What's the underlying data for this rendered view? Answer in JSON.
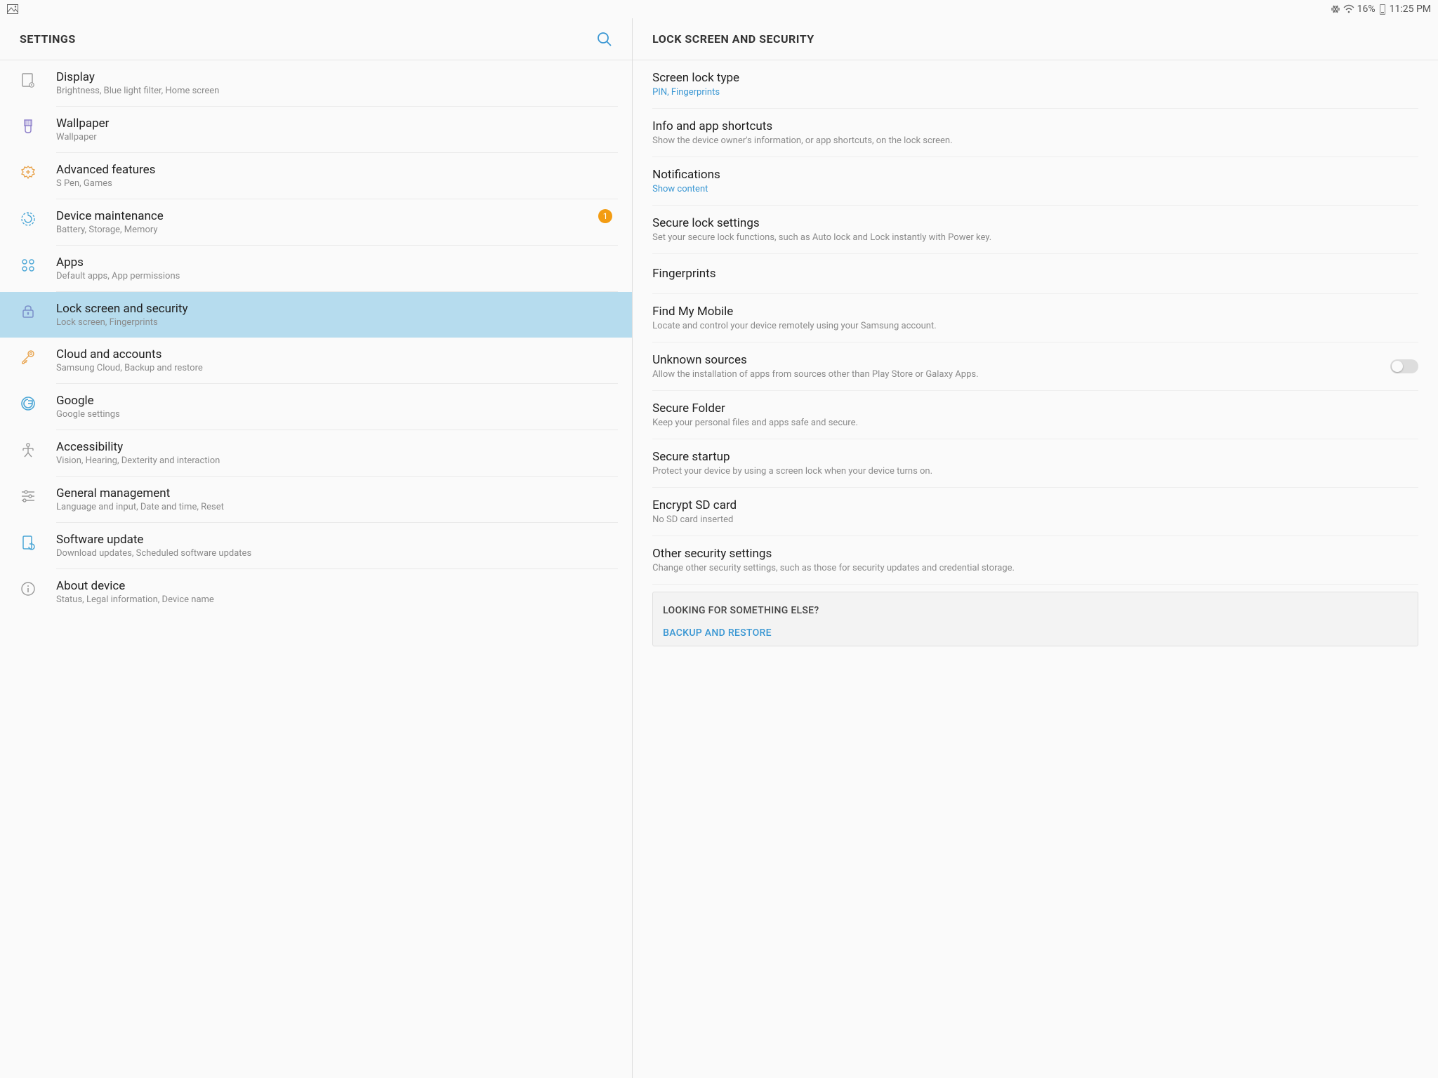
{
  "status": {
    "battery_pct": "16%",
    "time": "11:25 PM"
  },
  "left_header": "SETTINGS",
  "right_header": "LOCK SCREEN AND SECURITY",
  "sidebar": {
    "items": [
      {
        "title": "Display",
        "sub": "Brightness, Blue light filter, Home screen"
      },
      {
        "title": "Wallpaper",
        "sub": "Wallpaper"
      },
      {
        "title": "Advanced features",
        "sub": "S Pen, Games"
      },
      {
        "title": "Device maintenance",
        "sub": "Battery, Storage, Memory",
        "badge": "1"
      },
      {
        "title": "Apps",
        "sub": "Default apps, App permissions"
      },
      {
        "title": "Lock screen and security",
        "sub": "Lock screen, Fingerprints",
        "selected": true
      },
      {
        "title": "Cloud and accounts",
        "sub": "Samsung Cloud, Backup and restore"
      },
      {
        "title": "Google",
        "sub": "Google settings"
      },
      {
        "title": "Accessibility",
        "sub": "Vision, Hearing, Dexterity and interaction"
      },
      {
        "title": "General management",
        "sub": "Language and input, Date and time, Reset"
      },
      {
        "title": "Software update",
        "sub": "Download updates, Scheduled software updates"
      },
      {
        "title": "About device",
        "sub": "Status, Legal information, Device name"
      }
    ]
  },
  "details": {
    "items": [
      {
        "title": "Screen lock type",
        "sub": "PIN, Fingerprints",
        "link": true
      },
      {
        "title": "Info and app shortcuts",
        "sub": "Show the device owner's information, or app shortcuts, on the lock screen."
      },
      {
        "title": "Notifications",
        "sub": "Show content",
        "link": true
      },
      {
        "title": "Secure lock settings",
        "sub": "Set your secure lock functions, such as Auto lock and Lock instantly with Power key."
      }
    ],
    "fingerprints_header": "Fingerprints",
    "items2": [
      {
        "title": "Find My Mobile",
        "sub": "Locate and control your device remotely using your Samsung account."
      },
      {
        "title": "Unknown sources",
        "sub": "Allow the installation of apps from sources other than Play Store or Galaxy Apps.",
        "toggle": true
      },
      {
        "title": "Secure Folder",
        "sub": "Keep your personal files and apps safe and secure."
      },
      {
        "title": "Secure startup",
        "sub": "Protect your device by using a screen lock when your device turns on."
      },
      {
        "title": "Encrypt SD card",
        "sub": "No SD card inserted"
      },
      {
        "title": "Other security settings",
        "sub": "Change other security settings, such as those for security updates and credential storage."
      }
    ]
  },
  "looking": {
    "title": "LOOKING FOR SOMETHING ELSE?",
    "link1": "BACKUP AND RESTORE"
  }
}
